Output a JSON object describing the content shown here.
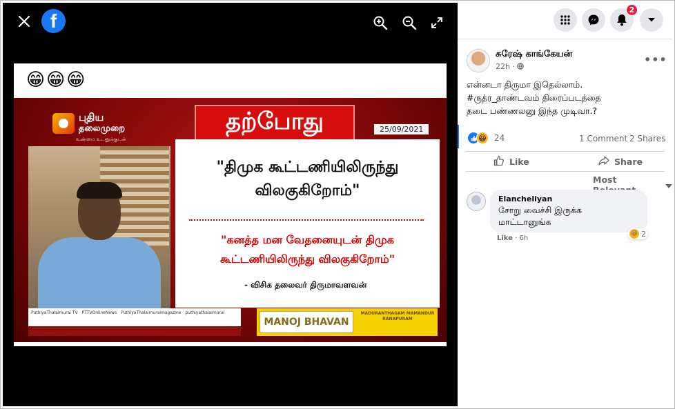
{
  "viewer": {
    "close_icon": "close-icon",
    "logo_letter": "f",
    "photo": {
      "emoji": [
        "😁",
        "😁",
        "😁"
      ],
      "channel_name": "புதிய",
      "channel_name2": "தலைமுறை",
      "channel_tagline": "உண்மை உடனுக்குடன்",
      "banner": "தற்போது",
      "date": "25/09/2021",
      "quote_main": "\"திமுக கூட்டணியிலிருந்து விலகுகிறோம்\"",
      "quote_sub": "\"கனத்த மன வேதனையுடன் திமுக கூட்டணியிலிருந்து விலகுகிறோம்\"",
      "signature": "- விசிக தலைவர் திருமாவளவன்",
      "ticker_items": [
        "PuthiyaThalaimurai TV",
        "PTTVOnlineNews",
        "PuthiyaThalaimuraimagazine",
        "puthiyathalaimurai"
      ],
      "sponsor_name": "MANOJ BHAVAN",
      "sponsor_address": "MADURANTHAGAM MAMANDUR RANAPURAM"
    }
  },
  "header": {
    "notifications_count": "2"
  },
  "post": {
    "author": "சுரேஷ் காங்கேயன்",
    "time": "22h ·",
    "caption_line1": "என்னடா திருமா இதெல்லாம்.",
    "caption_hashtag": "#ருத்ர_தாண்டவம்",
    "caption_line2_rest": " திரைப்படத்தை",
    "caption_line3": "தடை பண்ணலனு இந்த முடிவா.?",
    "reaction_count": "24",
    "comments": "1 Comment",
    "shares": "2 Shares",
    "like_label": "Like",
    "share_label": "Share",
    "sort_label": "Most Relevant"
  },
  "comment": {
    "author": "Elancheliyan",
    "text_line1": "சோறு வைச்சி இருக்க",
    "text_line2": "மாட்டானுங்க",
    "reaction_count": "2",
    "like_label": "Like",
    "time": "· 6h"
  }
}
